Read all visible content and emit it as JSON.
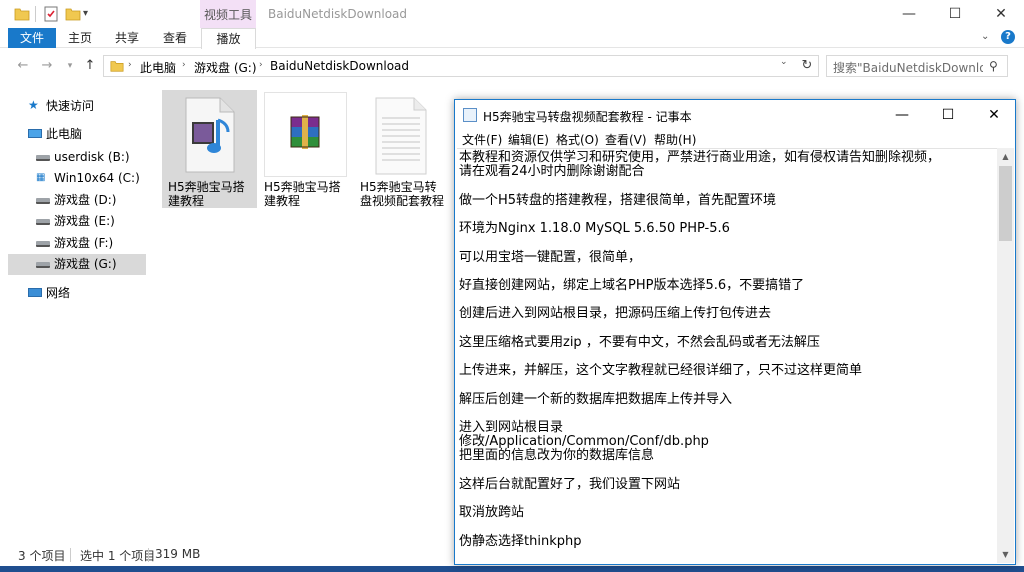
{
  "window": {
    "title": "BaiduNetdiskDownload",
    "context_tab_group": "视频工具",
    "controls": {
      "minimize": "—",
      "maximize": "☐",
      "close": "✕"
    }
  },
  "ribbon": {
    "tabs": [
      {
        "label": "文件"
      },
      {
        "label": "主页"
      },
      {
        "label": "共享"
      },
      {
        "label": "查看"
      },
      {
        "label": "播放"
      }
    ]
  },
  "address": {
    "breadcrumbs": [
      "此电脑",
      "游戏盘 (G:)",
      "BaiduNetdiskDownload"
    ]
  },
  "search": {
    "placeholder": "搜索\"BaiduNetdiskDownlo..."
  },
  "nav_pane": {
    "items": [
      {
        "label": "快速访问",
        "icon": "star-icon"
      },
      {
        "label": "此电脑",
        "icon": "computer-icon"
      },
      {
        "label": "userdisk (B:)",
        "icon": "drive-icon"
      },
      {
        "label": "Win10x64 (C:)",
        "icon": "windows-drive-icon"
      },
      {
        "label": "游戏盘 (D:)",
        "icon": "drive-icon"
      },
      {
        "label": "游戏盘 (E:)",
        "icon": "drive-icon"
      },
      {
        "label": "游戏盘 (F:)",
        "icon": "drive-icon"
      },
      {
        "label": "游戏盘 (G:)",
        "icon": "drive-icon"
      },
      {
        "label": "网络",
        "icon": "network-icon"
      }
    ]
  },
  "files": [
    {
      "name": "H5奔驰宝马搭建教程",
      "icon": "video-file-icon"
    },
    {
      "name": "H5奔驰宝马搭建教程",
      "icon": "rar-archive-icon"
    },
    {
      "name": "H5奔驰宝马转盘视频配套教程",
      "icon": "text-file-icon"
    }
  ],
  "status": {
    "count": "3 个项目",
    "selected": "选中 1 个项目",
    "size": "319 MB"
  },
  "notepad": {
    "title": "H5奔驰宝马转盘视频配套教程 - 记事本",
    "menus": [
      "文件(F)",
      "编辑(E)",
      "格式(O)",
      "查看(V)",
      "帮助(H)"
    ],
    "lines": [
      "本教程和资源仅供学习和研究使用，严禁进行商业用途，如有侵权请告知删除视频，",
      "请在观看24小时内删除谢谢配合",
      "做一个H5转盘的搭建教程，搭建很简单，首先配置环境",
      "环境为Nginx 1.18.0  MySQL 5.6.50  PHP-5.6",
      "可以用宝塔一键配置，很简单，",
      "好直接创建网站，绑定上域名PHP版本选择5.6，不要搞错了",
      "创建后进入到网站根目录，把源码压缩上传打包传进去",
      "这里压缩格式要用zip ，不要有中文，不然会乱码或者无法解压",
      "上传进来，并解压，这个文字教程就已经很详细了，只不过这样更简单",
      "解压后创建一个新的数据库把数据库上传并导入",
      "进入到网站根目录",
      "修改/Application/Common/Conf/db.php",
      "把里面的信息改为你的数据库信息",
      "这样后台就配置好了，我们设置下网站",
      "取消放跨站",
      "伪静态选择thinkphp"
    ]
  }
}
